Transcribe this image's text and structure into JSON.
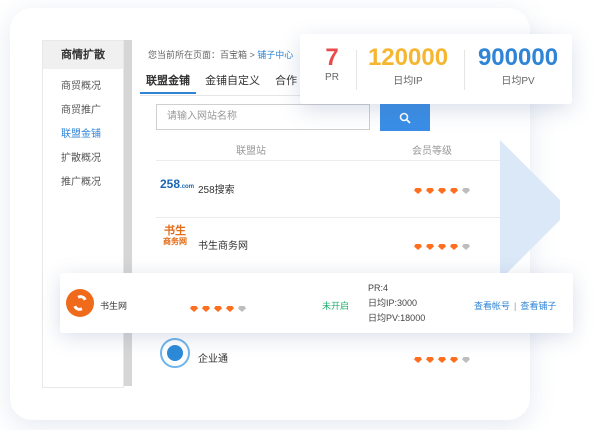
{
  "sidebar": {
    "header": "商情扩散",
    "items": [
      {
        "label": "商贸概况",
        "active": false
      },
      {
        "label": "商贸推广",
        "active": false
      },
      {
        "label": "联盟金铺",
        "active": true
      },
      {
        "label": "扩散概况",
        "active": false
      },
      {
        "label": "推广概况",
        "active": false
      }
    ]
  },
  "breadcrumb": {
    "prefix": "您当前所在页面：百宝箱",
    "sep": " > ",
    "current": "铺子中心"
  },
  "tabs": [
    "联盟金铺",
    "金铺自定义",
    "合作"
  ],
  "search": {
    "placeholder": "请输入网站名称",
    "button_icon": "search-icon"
  },
  "table": {
    "headers": [
      "联盟站",
      "会员等级"
    ],
    "rows": [
      {
        "logo": "258",
        "logo_sub": ".com",
        "site": "258搜索",
        "rating": 4
      },
      {
        "logo": "书生",
        "logo_sub": "商务网",
        "site": "书生商务网",
        "rating": 4
      },
      {
        "logo": "",
        "logo_sub": "",
        "site": "企业通",
        "rating": 4
      }
    ]
  },
  "stats": [
    {
      "value": "7",
      "label": "PR",
      "color": "#e94b4b"
    },
    {
      "value": "120000",
      "label": "日均IP",
      "color": "#f5b731"
    },
    {
      "value": "900000",
      "label": "日均PV",
      "color": "#2f84d6"
    }
  ],
  "floating_row": {
    "site": "书生网",
    "rating": 4,
    "status": "未开启",
    "info": [
      "PR:4",
      "日均IP:3000",
      "日均PV:18000"
    ],
    "links": [
      "查看帐号",
      "查看铺子"
    ],
    "link_separator": "|"
  },
  "colors": {
    "accent": "#2f84d6",
    "diamond": "#ff6e1f",
    "status_green": "#21b06d"
  }
}
